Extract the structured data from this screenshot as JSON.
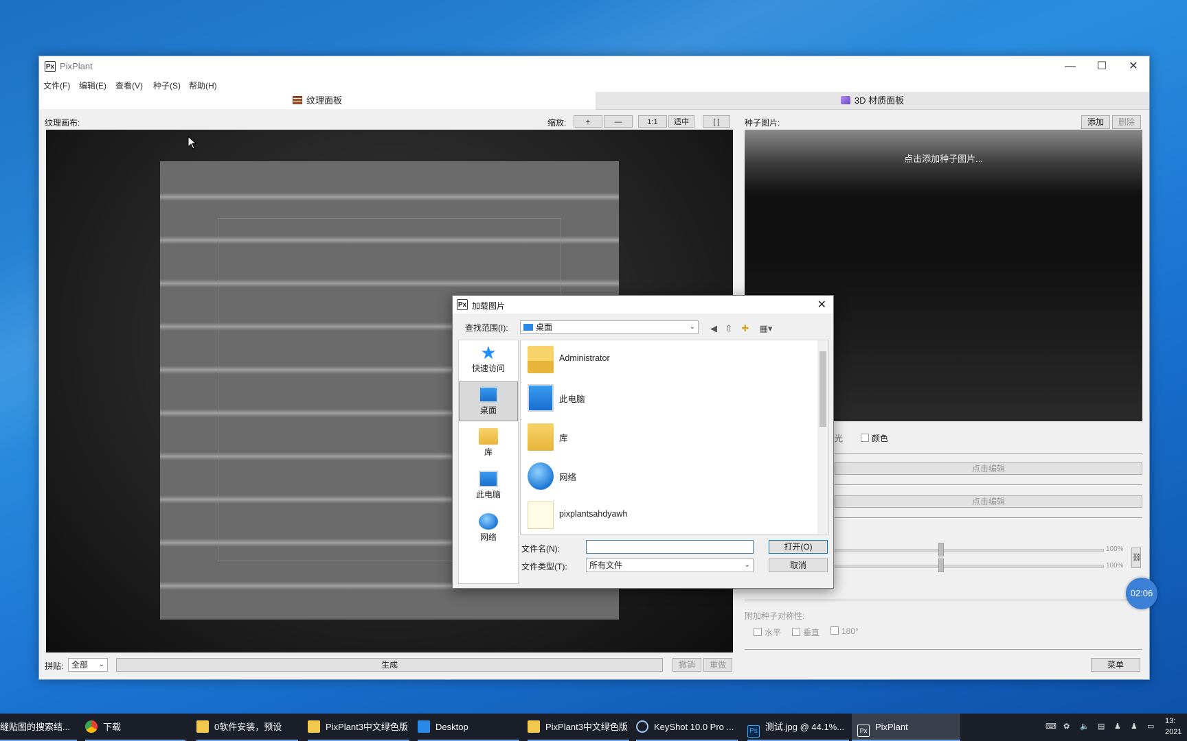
{
  "window": {
    "title": "PixPlant",
    "logo_text": "Px",
    "minimize": "—",
    "maximize": "☐",
    "close": "✕"
  },
  "menu": [
    "文件(F)",
    "编辑(E)",
    "查看(V)",
    "种子(S)",
    "帮助(H)"
  ],
  "tabs": {
    "texture": "纹理面板",
    "material": "3D 材质面板"
  },
  "left": {
    "canvas_label": "纹理画布:",
    "zoom_label": "缩放:",
    "zoom_buttons": [
      "+",
      "—",
      "1:1",
      "适中",
      "[ ]"
    ],
    "tile_label": "拼贴:",
    "tile_value": "全部",
    "generate": "生成",
    "undo": "撤销",
    "redo": "重做"
  },
  "right": {
    "seed_label": "种子图片:",
    "add": "添加",
    "delete": "删除",
    "seed_hint": "点击添加种子图片...",
    "partial_label": "光",
    "color_label": "颜色",
    "edit1": "点击编辑",
    "edit2": "点击编辑",
    "slider1_value": "100%",
    "slider2_value": "100%",
    "symmetry_label": "附加种子对称性:",
    "sym_h": "水平",
    "sym_v": "垂直",
    "sym_180": "180°",
    "menu_button": "菜单"
  },
  "timer": "02:06",
  "dialog": {
    "title": "加载图片",
    "close": "✕",
    "lookin_label": "查找范围(I):",
    "lookin_value": "桌面",
    "places": [
      "快速访问",
      "桌面",
      "库",
      "此电脑",
      "网络"
    ],
    "files": [
      "Administrator",
      "此电脑",
      "库",
      "网络",
      "pixplantsahdyawh"
    ],
    "filename_label": "文件名(N):",
    "filename_value": "",
    "filetype_label": "文件类型(T):",
    "filetype_value": "所有文件",
    "open": "打开(O)",
    "cancel": "取消"
  },
  "taskbar": [
    {
      "label": "缝贴图的搜索结...",
      "active": false
    },
    {
      "label": "下载",
      "active": false
    },
    {
      "label": "0软件安装，预设",
      "active": false
    },
    {
      "label": "PixPlant3中文绿色版",
      "active": false
    },
    {
      "label": "Desktop",
      "active": false
    },
    {
      "label": "PixPlant3中文绿色版",
      "active": false
    },
    {
      "label": "KeyShot 10.0 Pro ...",
      "active": false
    },
    {
      "label": "测试.jpg @ 44.1%...",
      "active": false
    },
    {
      "label": "PixPlant",
      "active": true
    }
  ],
  "clock": {
    "time": "13:",
    "date": "2021"
  }
}
